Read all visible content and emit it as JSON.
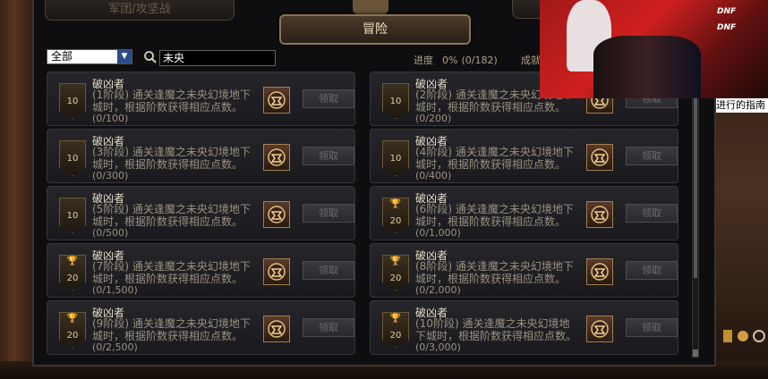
{
  "tabs": {
    "guild": "军团/攻坚战",
    "active": "冒险"
  },
  "filter": {
    "selected": "全部",
    "search_value": "未央"
  },
  "progress": {
    "label": "进度",
    "percent": "0%",
    "count": "(0/182)",
    "tail": "成就"
  },
  "cards": [
    {
      "title": "破凶者",
      "stage": "(1阶段)",
      "desc": "通关逢魔之未央幻境地下城时，根据阶数获得相应点数。",
      "progress": "(0/100)",
      "points": "10",
      "trophy": false,
      "claim": "领取"
    },
    {
      "title": "破凶者",
      "stage": "(2阶段)",
      "desc": "通关逢魔之未央幻境地下城时，根据阶数获得相应点数。",
      "progress": "(0/200)",
      "points": "10",
      "trophy": false,
      "claim": "领取"
    },
    {
      "title": "破凶者",
      "stage": "(3阶段)",
      "desc": "通关逢魔之未央幻境地下城时，根据阶数获得相应点数。",
      "progress": "(0/300)",
      "points": "10",
      "trophy": false,
      "claim": "领取"
    },
    {
      "title": "破凶者",
      "stage": "(4阶段)",
      "desc": "通关逢魔之未央幻境地下城时，根据阶数获得相应点数。",
      "progress": "(0/400)",
      "points": "10",
      "trophy": false,
      "claim": "领取"
    },
    {
      "title": "破凶者",
      "stage": "(5阶段)",
      "desc": "通关逢魔之未央幻境地下城时，根据阶数获得相应点数。",
      "progress": "(0/500)",
      "points": "10",
      "trophy": false,
      "claim": "领取"
    },
    {
      "title": "破凶者",
      "stage": "(6阶段)",
      "desc": "通关逢魔之未央幻境地下城时，根据阶数获得相应点数。",
      "progress": "(0/1,000)",
      "points": "20",
      "trophy": true,
      "claim": "领取"
    },
    {
      "title": "破凶者",
      "stage": "(7阶段)",
      "desc": "通关逢魔之未央幻境地下城时，根据阶数获得相应点数。",
      "progress": "(0/1,500)",
      "points": "20",
      "trophy": true,
      "claim": "领取"
    },
    {
      "title": "破凶者",
      "stage": "(8阶段)",
      "desc": "通关逢魔之未央幻境地下城时，根据阶数获得相应点数。",
      "progress": "(0/2,000)",
      "points": "20",
      "trophy": true,
      "claim": "领取"
    },
    {
      "title": "破凶者",
      "stage": "(9阶段)",
      "desc": "通关逢魔之未央幻境地下城时，根据阶数获得相应点数。",
      "progress": "(0/2,500)",
      "points": "20",
      "trophy": true,
      "claim": "领取"
    },
    {
      "title": "破凶者",
      "stage": "(10阶段)",
      "desc": "通关逢魔之未央幻境地下城时，根据阶数获得相应点数。",
      "progress": "(0/3,000)",
      "points": "20",
      "trophy": true,
      "claim": "领取"
    }
  ],
  "side_note": "进行的指南",
  "colors": {
    "accent": "#8a7452",
    "panel_bg": "#0e0e10",
    "card_bg": "#222226"
  }
}
